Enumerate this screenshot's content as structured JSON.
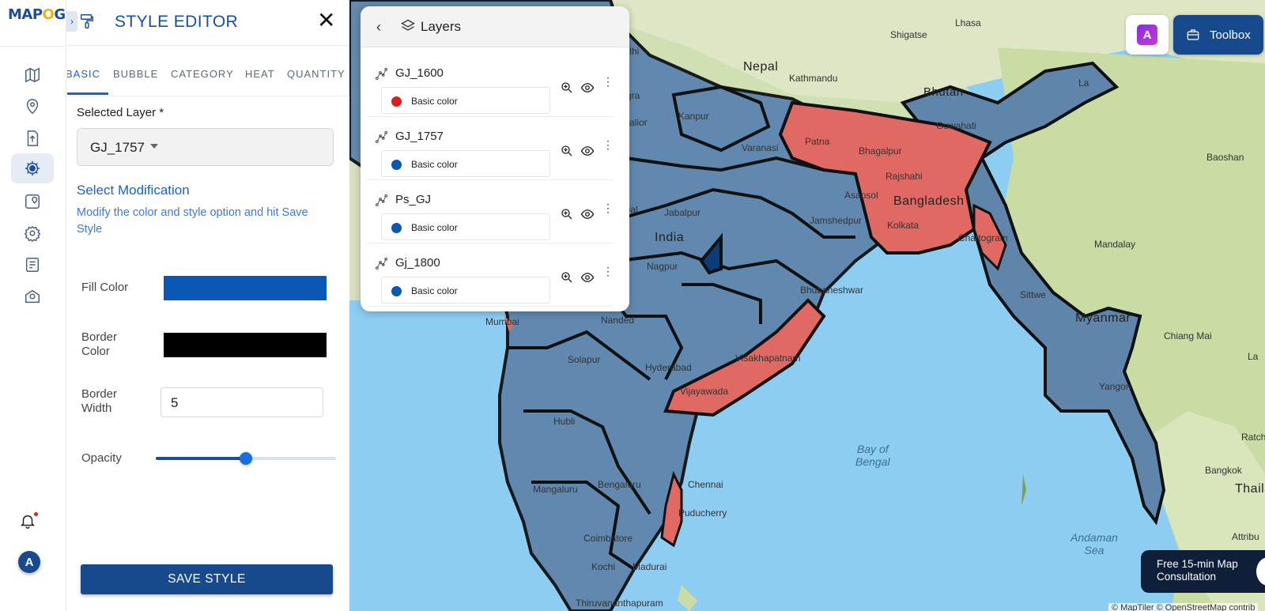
{
  "app": {
    "logo_a": "MAP",
    "logo_o": "O",
    "logo_g": "G",
    "toggle_glyph": "›"
  },
  "rail": {
    "icons": [
      "map-icon",
      "location-pin-icon",
      "upload-file-icon",
      "gear-icon",
      "map-marker-icon",
      "settings-icon",
      "checklist-icon",
      "map-pin-circle-icon"
    ],
    "active_index": 3,
    "avatar_initial": "A"
  },
  "editor": {
    "title": "STYLE EDITOR",
    "close_glyph": "✕",
    "tabs": [
      "BASIC",
      "BUBBLE",
      "CATEGORY",
      "HEAT",
      "QUANTITY"
    ],
    "active_tab": "BASIC",
    "selected_layer_label": "Selected Layer *",
    "selected_layer_value": "GJ_1757",
    "modification_title": "Select Modification",
    "modification_desc": "Modify the color and style option and hit Save Style",
    "fill_color_label": "Fill Color",
    "fill_color": "#0b57b5",
    "border_color_label_1": "Border",
    "border_color_label_2": "Color",
    "border_color": "#000000",
    "border_width_label_1": "Border",
    "border_width_label_2": "Width",
    "border_width_value": "5",
    "opacity_label": "Opacity",
    "opacity_value": 0.5,
    "save_label": "SAVE STYLE"
  },
  "layers_panel": {
    "title": "Layers",
    "back_glyph": "‹",
    "items": [
      {
        "name": "GJ_1600",
        "color_label": "Basic color",
        "color": "#d91e1e"
      },
      {
        "name": "GJ_1757",
        "color_label": "Basic color",
        "color": "#0b57b5"
      },
      {
        "name": "Ps_GJ",
        "color_label": "Basic color",
        "color": "#0b57b5"
      },
      {
        "name": "Gj_1800",
        "color_label": "Basic color",
        "color": "#0b57b5"
      }
    ]
  },
  "map": {
    "labels": {
      "nepal": "Nepal",
      "kathmandu": "Kathmandu",
      "bhutan": "Bhutan",
      "lhasa": "Lhasa",
      "shigatse": "Shigatse",
      "delhi": "Delhi",
      "agra": "Agra",
      "gwalior": "Gwalior",
      "kanpur": "Kanpur",
      "varanasi": "Varanasi",
      "patna": "Patna",
      "bhagalpur": "Bhagalpur",
      "rajshahi": "Rajshahi",
      "guwahati": "Guwahati",
      "asansol": "Asansol",
      "bangladesh": "Bangladesh",
      "kolkata": "Kolkata",
      "jamshedpur": "Jamshedpur",
      "jabalpur": "Jabalpur",
      "india": "India",
      "nagpur": "Nagpur",
      "bhubaneswar": "Bhubaneshwar",
      "chattogram": "Chattogram",
      "mumbai": "Mumbai",
      "nanded": "Nanded",
      "solapur": "Solapur",
      "hyderabad": "Hyderabad",
      "visakhapatnam": "Visakhapatnam",
      "vijayawada": "Vijayawada",
      "hubli": "Hubli",
      "mangaluru": "Mangaluru",
      "bengaluru": "Bengaluru",
      "chennai": "Chennai",
      "puducherry": "Puducherry",
      "coimbatore": "Coimbatore",
      "madurai": "Madurai",
      "kochi": "Kochi",
      "thiruvananthapuram": "Thiruvananthapuram",
      "bay_of_bengal_1": "Bay of",
      "bay_of_bengal_2": "Bengal",
      "andaman_1": "Andaman",
      "andaman_2": "Sea",
      "myanmar": "Myanmar",
      "mandalay": "Mandalay",
      "sittwe": "Sittwe",
      "yangon": "Yangon",
      "chiang_mai": "Chiang Mai",
      "bangkok": "Bangkok",
      "thaila": "Thaila",
      "baoshan": "Baoshan",
      "attribu": "Attribu",
      "bhopal": "opal",
      "la": "La",
      "ratch": "Ratch"
    }
  },
  "ai_button_label": "A",
  "toolbox_label": "Toolbox",
  "consult_line1": "Free 15-min Map",
  "consult_line2": "Consultation",
  "attribution": "© MapTiler © OpenStreetMap contrib"
}
